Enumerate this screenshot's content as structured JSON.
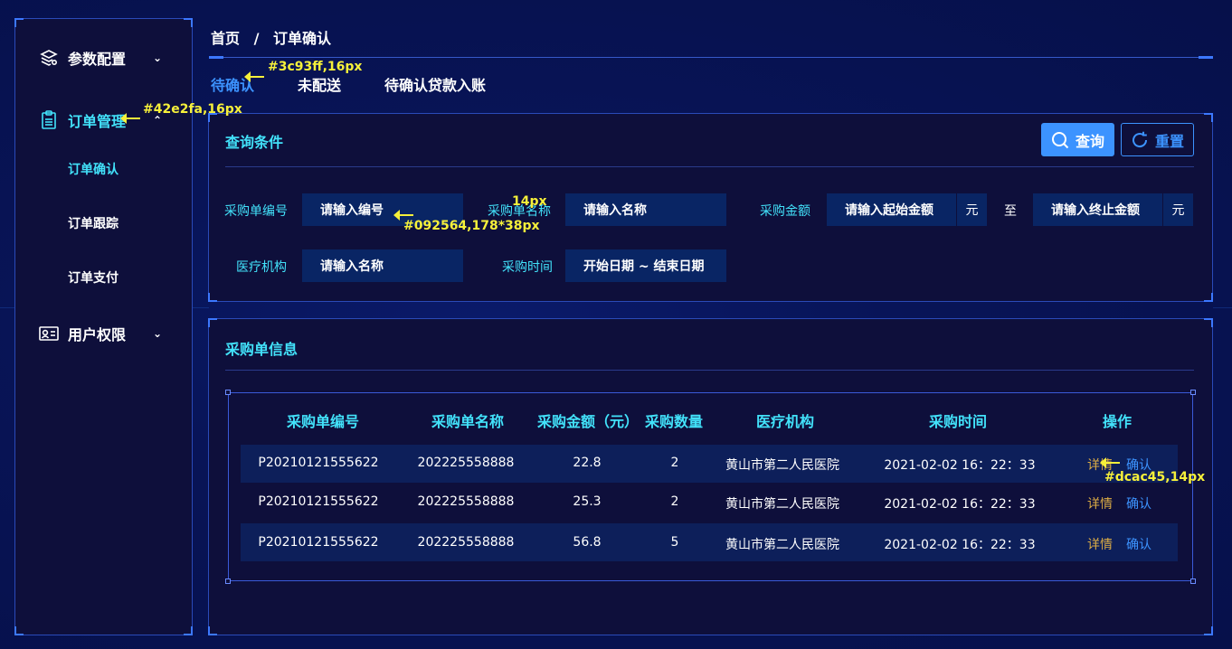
{
  "sidebar": {
    "groups": [
      {
        "label": "参数配置",
        "icon": "layers-gear-icon",
        "expanded": false
      },
      {
        "label": "订单管理",
        "icon": "clipboard-icon",
        "expanded": true
      },
      {
        "label": "用户权限",
        "icon": "id-card-icon",
        "expanded": false
      }
    ],
    "sub_items": [
      "订单确认",
      "订单跟踪",
      "订单支付"
    ],
    "active_sub": "订单确认"
  },
  "breadcrumb": {
    "home": "首页",
    "separator": "/",
    "current": "订单确认"
  },
  "tabs": [
    {
      "label": "待确认",
      "active": true
    },
    {
      "label": "未配送",
      "active": false
    },
    {
      "label": "待确认贷款入账",
      "active": false
    }
  ],
  "query_panel": {
    "title": "查询条件",
    "query_button": "查询",
    "reset_button": "重置",
    "fields": {
      "order_no": {
        "label": "采购单编号",
        "placeholder": "请输入编号"
      },
      "order_name": {
        "label": "采购单名称",
        "placeholder": "请输入名称"
      },
      "amount": {
        "label": "采购金额",
        "start_placeholder": "请输入起始金额",
        "end_placeholder": "请输入终止金额",
        "unit": "元",
        "to": "至"
      },
      "institution": {
        "label": "医疗机构",
        "placeholder": "请输入名称"
      },
      "date": {
        "label": "采购时间",
        "placeholder": "开始日期 ~ 结束日期"
      }
    }
  },
  "table_panel": {
    "title": "采购单信息",
    "columns": [
      "采购单编号",
      "采购单名称",
      "采购金额（元）",
      "采购数量",
      "医疗机构",
      "采购时间",
      "操作"
    ],
    "rows": [
      {
        "no": "P20210121555622",
        "name": "202225558888",
        "amount": "22.8",
        "qty": "2",
        "inst": "黄山市第二人民医院",
        "time": "2021-02-02 16：22：33",
        "detail": "详情",
        "confirm": "确认"
      },
      {
        "no": "P20210121555622",
        "name": "202225558888",
        "amount": "25.3",
        "qty": "2",
        "inst": "黄山市第二人民医院",
        "time": "2021-02-02 16：22：33",
        "detail": "详情",
        "confirm": "确认"
      },
      {
        "no": "P20210121555622",
        "name": "202225558888",
        "amount": "56.8",
        "qty": "5",
        "inst": "黄山市第二人民医院",
        "time": "2021-02-02 16：22：33",
        "detail": "详情",
        "confirm": "确认"
      }
    ]
  },
  "annotations": {
    "tab_active": "#3c93ff,16px",
    "menu_active": "#42e2fa,16px",
    "label_size": "14px",
    "input_spec": "#092564,178*38px",
    "detail_spec": "#dcac45,14px"
  },
  "colors": {
    "accent_blue": "#3c93ff",
    "accent_cyan": "#42e2fa",
    "input_bg": "#092564",
    "detail_gold": "#dcac45",
    "panel_bg": "#0e0f3b",
    "annotation_yellow": "#f6f03a"
  }
}
